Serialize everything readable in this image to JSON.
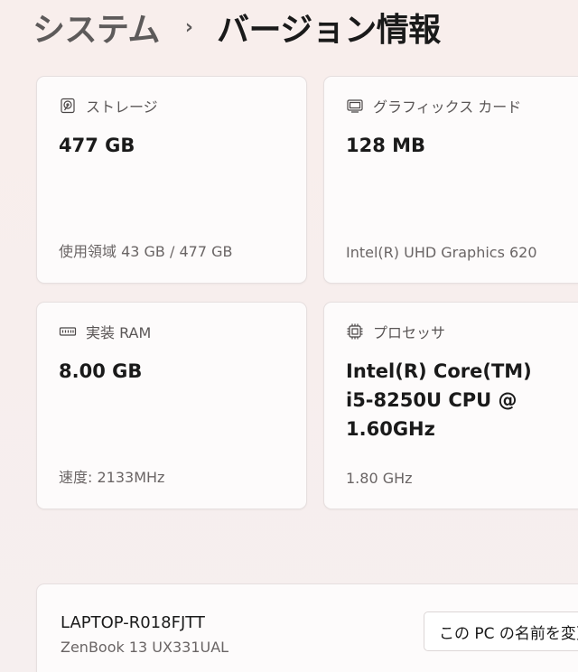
{
  "header": {
    "breadcrumb_parent": "システム",
    "breadcrumb_separator": "›",
    "breadcrumb_current": "バージョン情報"
  },
  "cards": {
    "storage": {
      "icon": "hard-drive-icon",
      "label": "ストレージ",
      "value": "477 GB",
      "detail": "使用領域 43 GB / 477 GB"
    },
    "graphics": {
      "icon": "monitor-icon",
      "label": "グラフィックス カード",
      "value": "128 MB",
      "detail": "Intel(R) UHD Graphics 620"
    },
    "ram": {
      "icon": "memory-icon",
      "label": "実装 RAM",
      "value": "8.00 GB",
      "detail": "速度: 2133MHz"
    },
    "processor": {
      "icon": "cpu-icon",
      "label": "プロセッサ",
      "value_lines": [
        "Intel(R) Core(TM)",
        "i5-8250U CPU @",
        "1.60GHz"
      ],
      "detail": "1.80 GHz"
    }
  },
  "device": {
    "name": "LAPTOP-R018FJTT",
    "model": "ZenBook 13 UX331UAL",
    "rename_button_label": "この PC の名前を変更"
  }
}
